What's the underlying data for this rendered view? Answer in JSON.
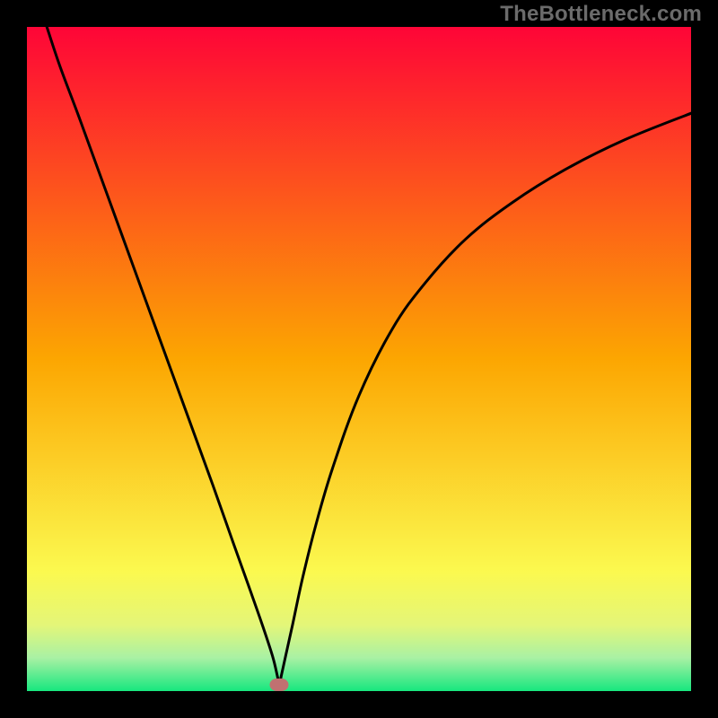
{
  "watermark": "TheBottleneck.com",
  "colors": {
    "top": "#fe0537",
    "mid": "#fca601",
    "low1": "#fbf94f",
    "low2": "#e4f678",
    "low3": "#a9f1a4",
    "bottom": "#17e77f",
    "curve": "#000000",
    "marker": "#c07171",
    "frame": "#000000"
  },
  "chart_data": {
    "type": "line",
    "title": "",
    "xlabel": "",
    "ylabel": "",
    "xlim": [
      0,
      100
    ],
    "ylim": [
      0,
      100
    ],
    "series": [
      {
        "name": "bottleneck-curve",
        "x": [
          3.0,
          5.0,
          8.0,
          12.0,
          16.0,
          20.0,
          24.0,
          28.0,
          31.0,
          33.5,
          35.5,
          37.0,
          37.7,
          38.0,
          38.3,
          39.0,
          40.0,
          41.5,
          43.5,
          46.0,
          50.0,
          55.0,
          60.0,
          66.0,
          73.0,
          81.0,
          90.0,
          100.0
        ],
        "y": [
          100.0,
          94.0,
          86.0,
          75.0,
          64.0,
          53.0,
          42.0,
          31.0,
          22.5,
          15.5,
          9.8,
          5.2,
          2.3,
          1.0,
          2.3,
          5.5,
          10.0,
          17.0,
          25.0,
          33.5,
          44.5,
          54.5,
          61.5,
          68.0,
          73.5,
          78.5,
          83.0,
          87.0
        ]
      }
    ],
    "annotations": [
      {
        "name": "minimum-marker",
        "x": 38.0,
        "y": 1.0,
        "shape": "ellipse",
        "color": "#c07171"
      }
    ],
    "background_gradient_stops": [
      {
        "pos": 0.0,
        "color": "#fe0537"
      },
      {
        "pos": 0.5,
        "color": "#fca601"
      },
      {
        "pos": 0.82,
        "color": "#fbf94f"
      },
      {
        "pos": 0.9,
        "color": "#e4f678"
      },
      {
        "pos": 0.95,
        "color": "#a9f1a4"
      },
      {
        "pos": 1.0,
        "color": "#17e77f"
      }
    ]
  }
}
